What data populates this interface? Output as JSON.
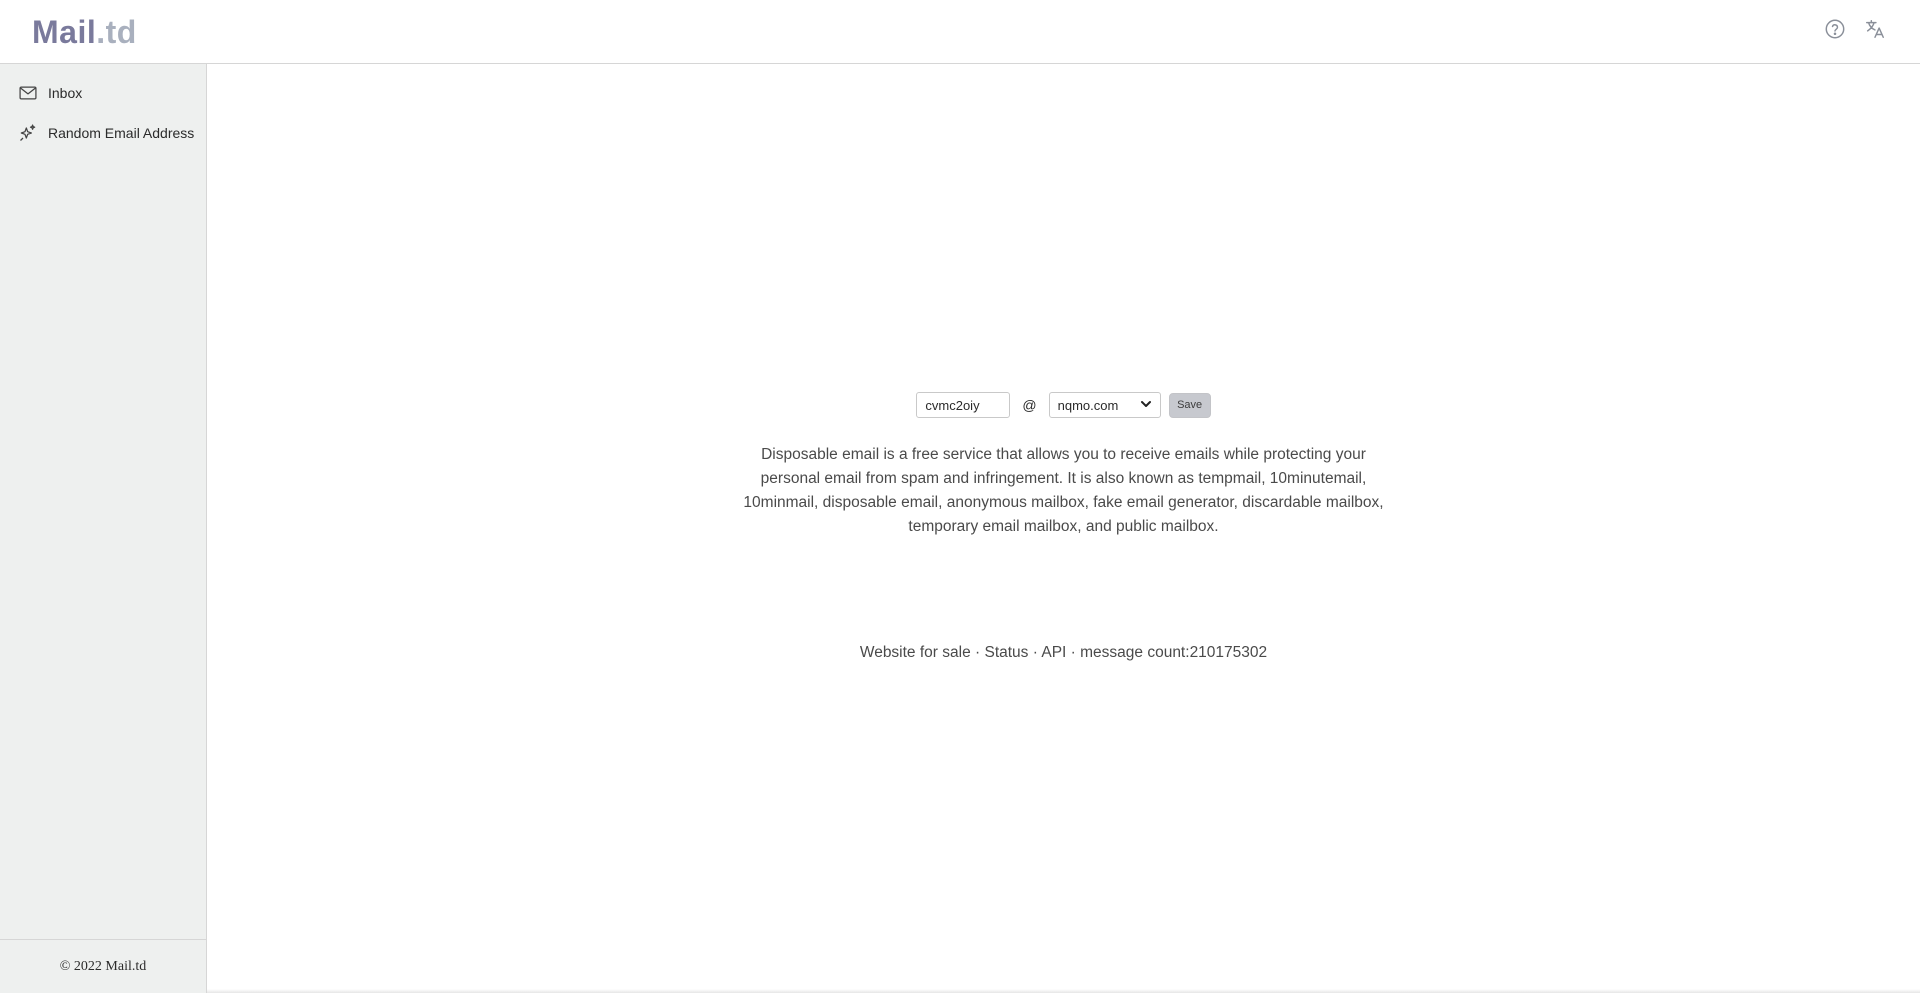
{
  "header": {
    "logo_part1": "Mail",
    "logo_part2": ".td",
    "help_icon": "help-circle-icon",
    "language_icon": "translate-icon"
  },
  "sidebar": {
    "items": [
      {
        "label": "Inbox",
        "icon": "mail-icon"
      },
      {
        "label": "Random Email Address",
        "icon": "sparkles-icon"
      }
    ],
    "footer": "© 2022 Mail.td"
  },
  "form": {
    "local_part_value": "cvmc2oiy",
    "at_symbol": "@",
    "domain_selected": "nqmo.com",
    "save_label": "Save"
  },
  "description": "Disposable email is a free service that allows you to receive emails while protecting your personal email from spam and infringement. It is also known as tempmail, 10minutemail, 10minmail, disposable email, anonymous mailbox, fake email generator, discardable mailbox, temporary email mailbox, and public mailbox.",
  "footer": {
    "link_sale": "Website for sale",
    "sep": " · ",
    "link_status": "Status",
    "link_api": "API",
    "count_label": "message count:",
    "count_value": "210175302"
  },
  "colors": {
    "logo_dark": "#7a7a9c",
    "logo_light": "#a9b0be",
    "sidebar_bg": "#eef0ef",
    "save_bg": "#c7c9cf"
  }
}
